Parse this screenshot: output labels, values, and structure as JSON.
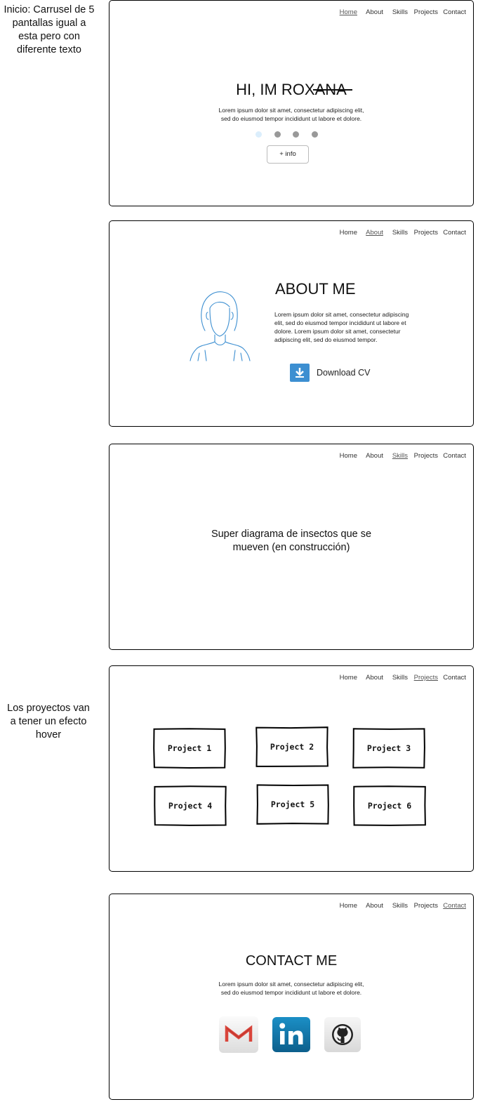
{
  "notes": {
    "carousel": "Inicio: Carrusel de 5 pantallas igual a esta pero con diferente texto",
    "projects_hover": "Los proyectos van a tener un efecto hover"
  },
  "nav": [
    "Home",
    "About",
    "Skills",
    "Projects",
    "Contact"
  ],
  "home": {
    "title": "HI, IM ROXANA",
    "lorem_line1": "Lorem ipsum dolor sit amet, consectetur adipiscing elit,",
    "lorem_line2": "sed do eiusmod tempor incididunt ut labore et dolore.",
    "button": "+ info",
    "carousel_active_dot": 1
  },
  "about": {
    "title": "ABOUT ME",
    "text": "Lorem ipsum dolor sit amet, consectetur adipiscing elit, sed do eiusmod tempor incididunt ut labore et dolore. Lorem ipsum dolor sit amet, consectetur  adipiscing elit, sed do eiusmod tempor.",
    "download": "Download CV"
  },
  "skills": {
    "line1": "Super diagrama de insectos que se",
    "line2": "mueven (en construcción)"
  },
  "projects": {
    "items": [
      "Project 1",
      "Project 2",
      "Project 3",
      "Project 4",
      "Project 5",
      "Project 6"
    ]
  },
  "contact": {
    "title": "CONTACT ME",
    "lorem_line1": "Lorem ipsum dolor sit amet, consectetur adipiscing elit,",
    "lorem_line2": "sed do eiusmod tempor incididunt ut labore et dolore.",
    "social": [
      "gmail-icon",
      "linkedin-icon",
      "github-icon"
    ]
  },
  "colors": {
    "accent_blue": "#3d8fd1",
    "dot_active": "#dbeefc",
    "dot_inactive": "#999999",
    "linkedin": "#0e76a8",
    "gmail_red": "#d9453b"
  }
}
